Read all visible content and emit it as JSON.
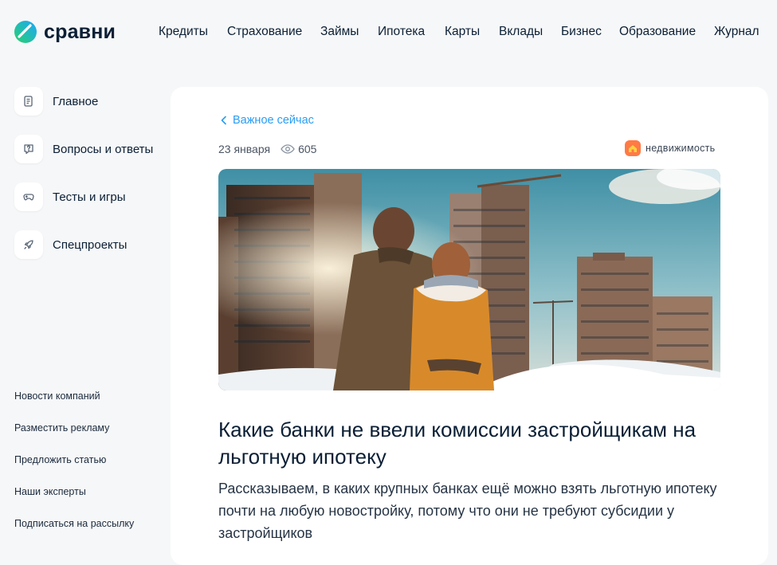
{
  "brand": {
    "name": "сравни"
  },
  "nav": [
    "Кредиты",
    "Страхование",
    "Займы",
    "Ипотека",
    "Карты",
    "Вклады",
    "Бизнес",
    "Образование",
    "Журнал"
  ],
  "sidebar": {
    "items": [
      {
        "label": "Главное",
        "icon": "article-icon"
      },
      {
        "label": "Вопросы и ответы",
        "icon": "question-icon"
      },
      {
        "label": "Тесты и игры",
        "icon": "gamepad-icon"
      },
      {
        "label": "Спецпроекты",
        "icon": "rocket-icon"
      }
    ],
    "footer_links": [
      "Новости компаний",
      "Разместить рекламу",
      "Предложить статью",
      "Наши эксперты",
      "Подписаться на рассылку"
    ]
  },
  "article": {
    "back_label": "Важное сейчас",
    "date": "23 января",
    "views": "605",
    "tag": "недвижимость",
    "title": "Какие банки не ввели комиссии застройщикам на льготную ипотеку",
    "lead": "Рассказываем, в каких крупных банках ещё можно взять льготную ипотеку почти на любую новостройку, потому что они не требуют субсидии у застройщиков"
  },
  "colors": {
    "accent": "#2a9df4",
    "background": "#f6f7f8",
    "tag": "#ff7a45"
  }
}
